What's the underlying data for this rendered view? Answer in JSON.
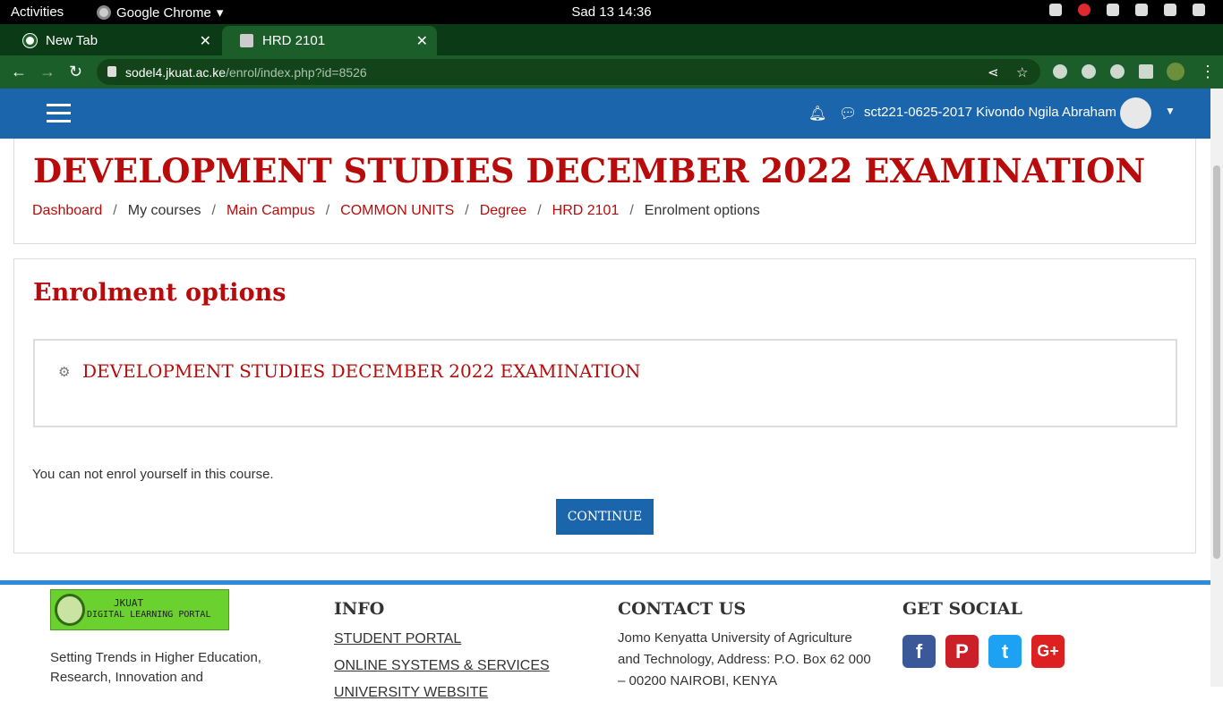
{
  "system": {
    "activities": "Activities",
    "app": "Google Chrome",
    "clock": "Sad 13  14:36"
  },
  "tabs": [
    {
      "label": "New Tab"
    },
    {
      "label": "HRD 2101"
    }
  ],
  "address": {
    "host": "sodel4.jkuat.ac.ke",
    "path": "/enrol/index.php?id=8526"
  },
  "header": {
    "user": "sct221-0625-2017 Kivondo Ngila Abraham"
  },
  "page": {
    "title": "DEVELOPMENT STUDIES DECEMBER 2022 EXAMINATION",
    "breadcrumbs": [
      "Dashboard",
      "My courses",
      "Main Campus",
      "COMMON UNITS",
      "Degree",
      "HRD 2101",
      "Enrolment options"
    ],
    "section_title": "Enrolment options",
    "course_name": "DEVELOPMENT STUDIES DECEMBER 2022 EXAMINATION",
    "notice": "You can not enrol yourself in this course.",
    "continue_label": "CONTINUE"
  },
  "footer": {
    "logo_line1": "JKUAT",
    "logo_line2": "DIGITAL LEARNING PORTAL",
    "tagline": "Setting Trends in Higher Education, Research, Innovation and",
    "info_heading": "INFO",
    "info_links": [
      "STUDENT PORTAL",
      "ONLINE SYSTEMS & SERVICES",
      "UNIVERSITY WEBSITE"
    ],
    "contact_heading": "CONTACT US",
    "contact_text": "Jomo Kenyatta University of Agriculture and Technology, Address: P.O. Box 62 000 – 00200 NAIROBI, KENYA",
    "social_heading": "GET SOCIAL",
    "social": [
      {
        "name": "facebook",
        "glyph": "f",
        "color": "#3b5998"
      },
      {
        "name": "pinterest",
        "glyph": "P",
        "color": "#cb2027"
      },
      {
        "name": "twitter",
        "glyph": "t",
        "color": "#1da1f2"
      },
      {
        "name": "google-plus",
        "glyph": "G+",
        "color": "#dd2020"
      }
    ]
  }
}
